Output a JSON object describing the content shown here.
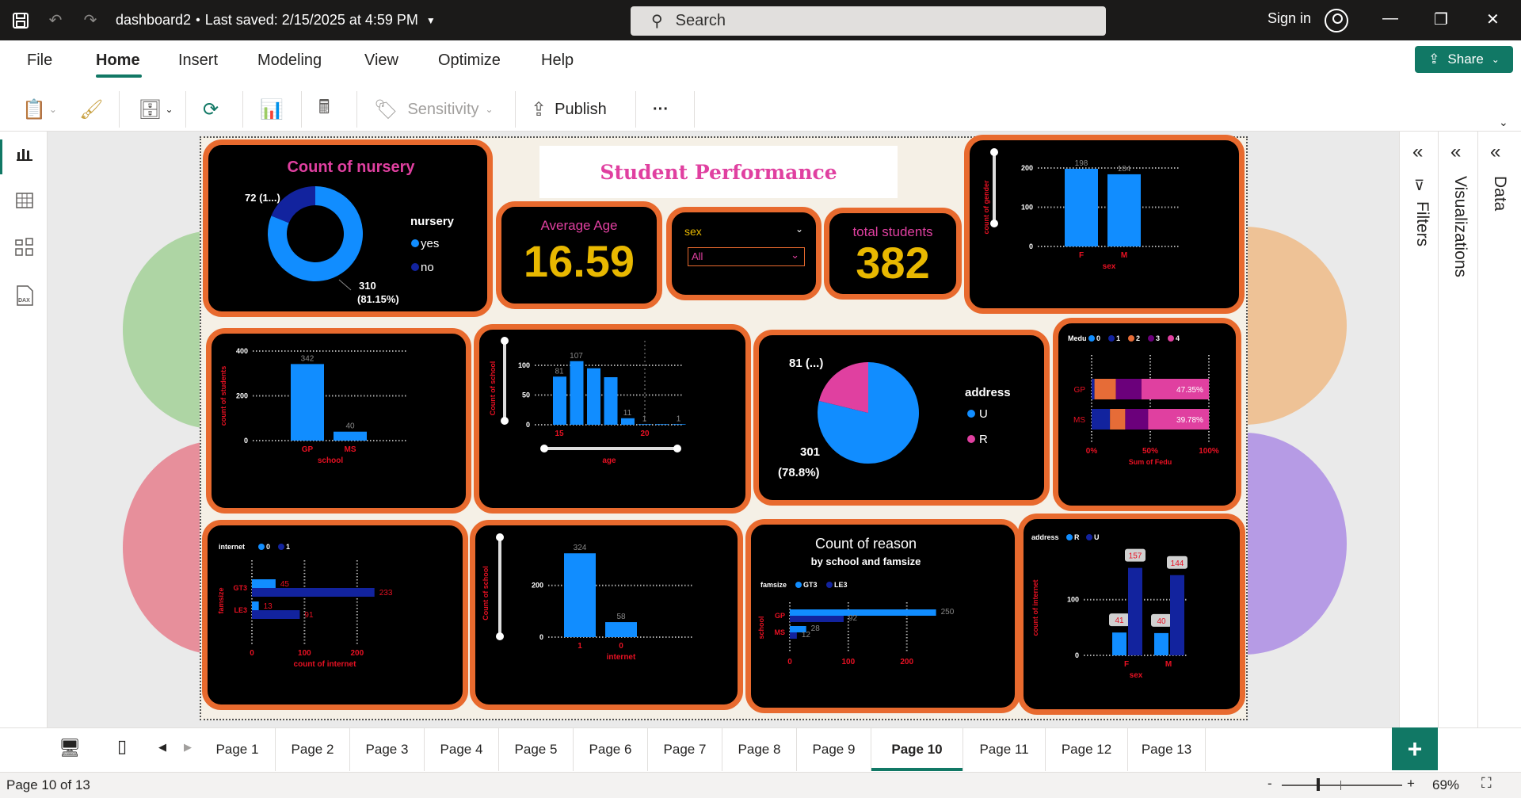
{
  "app": {
    "title": "dashboard2",
    "saved": "Last saved: 2/15/2025 at 4:59 PM",
    "search_placeholder": "Search",
    "signin": "Sign in"
  },
  "menu": [
    "File",
    "Home",
    "Insert",
    "Modeling",
    "View",
    "Optimize",
    "Help"
  ],
  "share": "Share",
  "ribbon": {
    "sensitivity": "Sensitivity",
    "publish": "Publish",
    "more": "···"
  },
  "panes": {
    "filters": "Filters",
    "visualizations": "Visualizations",
    "data": "Data"
  },
  "tabs": [
    "Page 1",
    "Page 2",
    "Page 3",
    "Page 4",
    "Page 5",
    "Page 6",
    "Page 7",
    "Page 8",
    "Page 9",
    "Page 10",
    "Page 11",
    "Page 12",
    "Page 13"
  ],
  "active_tab": "Page 10",
  "status": {
    "page": "Page 10 of 13",
    "zoom": "69%",
    "minus": "-",
    "plus": "+"
  },
  "report": {
    "title": "Student Performance",
    "avg_age": {
      "label": "Average Age",
      "value": "16.59"
    },
    "total_students": {
      "label": "total students",
      "value": "382"
    },
    "slicer": {
      "label": "sex",
      "value": "All"
    }
  },
  "colors": {
    "accent": "#117865",
    "card_border": "#e86a2e",
    "blue": "#118dff",
    "navy": "#12239e",
    "pink": "#e040a0",
    "gold": "#e8b800",
    "orange": "#e66c37",
    "purple": "#6b007b",
    "red": "#e81123"
  },
  "chart_data": [
    {
      "id": "nursery",
      "type": "pie",
      "title": "Count of nursery",
      "legend_title": "nursery",
      "labels": [
        "yes",
        "no"
      ],
      "values": [
        310,
        72
      ],
      "data_labels": [
        "310 (81.15%)",
        "72 (1...)"
      ]
    },
    {
      "id": "gender",
      "type": "bar",
      "ylabel": "count of gender",
      "xlabel": "sex",
      "categories": [
        "F",
        "M"
      ],
      "values": [
        198,
        184
      ],
      "ylim": [
        0,
        200
      ],
      "yticks": [
        "0",
        "100",
        "200"
      ]
    },
    {
      "id": "school",
      "type": "bar",
      "ylabel": "count of students",
      "xlabel": "school",
      "categories": [
        "GP",
        "MS"
      ],
      "values": [
        342,
        40
      ],
      "ylim": [
        0,
        400
      ],
      "yticks": [
        "0",
        "200",
        "400"
      ]
    },
    {
      "id": "age",
      "type": "bar",
      "ylabel": "Count of school",
      "xlabel": "age",
      "categories": [
        "15",
        "16",
        "17",
        "18",
        "19",
        "20",
        "21",
        "22"
      ],
      "values": [
        81,
        107,
        95,
        80,
        11,
        1,
        1,
        1
      ],
      "ylim": [
        0,
        120
      ],
      "yticks": [
        "0",
        "50",
        "100"
      ],
      "xticks": [
        "15",
        "20"
      ],
      "data_labels": [
        "81",
        "107",
        "",
        "",
        "11",
        "1",
        "",
        "1"
      ]
    },
    {
      "id": "address",
      "type": "pie",
      "legend_title": "address",
      "labels": [
        "U",
        "R"
      ],
      "values": [
        301,
        81
      ],
      "data_labels": [
        "301 (78.8%)",
        "81 (...)"
      ]
    },
    {
      "id": "medu",
      "type": "bar",
      "legend_title": "Medu",
      "xlabel": "Sum of Fedu",
      "legend": [
        "0",
        "1",
        "2",
        "3",
        "4"
      ],
      "categories": [
        "GP",
        "MS"
      ],
      "series": [
        {
          "name": "0",
          "values": [
            0,
            0
          ]
        },
        {
          "name": "1",
          "values": [
            2,
            12
          ]
        },
        {
          "name": "2",
          "values": [
            15,
            10
          ]
        },
        {
          "name": "3",
          "values": [
            18,
            15
          ]
        },
        {
          "name": "4",
          "values": [
            47.35,
            39.78
          ]
        }
      ],
      "data_labels": [
        "47.35%",
        "39.78%"
      ],
      "xticks": [
        "0%",
        "50%",
        "100%"
      ]
    },
    {
      "id": "internet",
      "type": "bar",
      "legend_title": "internet",
      "legend": [
        "0",
        "1"
      ],
      "ylabel": "famsize",
      "xlabel": "count of internet",
      "categories": [
        "GT3",
        "LE3"
      ],
      "series": [
        {
          "name": "0",
          "values": [
            45,
            13
          ]
        },
        {
          "name": "1",
          "values": [
            233,
            91
          ]
        }
      ],
      "xlim": [
        0,
        250
      ],
      "xticks": [
        "0",
        "100",
        "200"
      ]
    },
    {
      "id": "internet_school",
      "type": "bar",
      "ylabel": "Count of school",
      "xlabel": "internet",
      "categories": [
        "1",
        "0"
      ],
      "values": [
        324,
        58
      ],
      "ylim": [
        0,
        340
      ],
      "yticks": [
        "0",
        "200"
      ]
    },
    {
      "id": "reason",
      "type": "bar",
      "title": "Count of reason",
      "subtitle": "by school and famsize",
      "legend_title": "famsize",
      "legend": [
        "GT3",
        "LE3"
      ],
      "ylabel": "school",
      "categories": [
        "GP",
        "MS"
      ],
      "series": [
        {
          "name": "GT3",
          "values": [
            250,
            28
          ]
        },
        {
          "name": "LE3",
          "values": [
            92,
            12
          ]
        }
      ],
      "xlim": [
        0,
        260
      ],
      "xticks": [
        "0",
        "100",
        "200"
      ]
    },
    {
      "id": "sex_address",
      "type": "bar",
      "legend_title": "address",
      "legend": [
        "R",
        "U"
      ],
      "ylabel": "count of internet",
      "xlabel": "sex",
      "categories": [
        "F",
        "M"
      ],
      "series": [
        {
          "name": "R",
          "values": [
            41,
            40
          ]
        },
        {
          "name": "U",
          "values": [
            157,
            144
          ]
        }
      ],
      "ylim": [
        0,
        165
      ],
      "yticks": [
        "0",
        "100"
      ]
    }
  ]
}
